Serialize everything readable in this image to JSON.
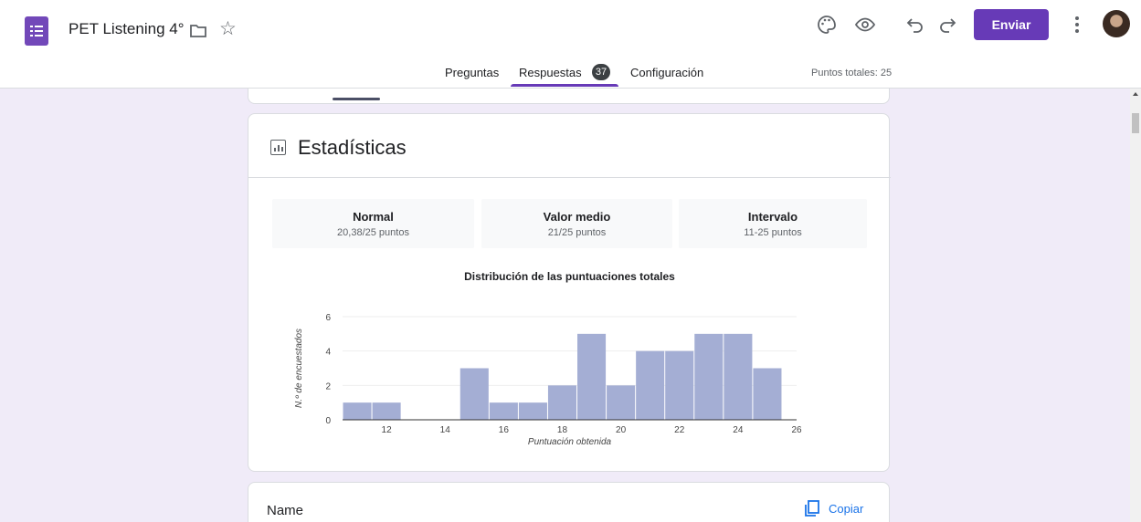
{
  "header": {
    "title": "PET Listening 4°",
    "send_label": "Enviar"
  },
  "tabs": [
    {
      "label": "Preguntas"
    },
    {
      "label": "Respuestas",
      "badge": "37"
    },
    {
      "label": "Configuración"
    }
  ],
  "total_points": "Puntos totales: 25",
  "stats": {
    "title": "Estadísticas",
    "boxes": [
      {
        "label": "Normal",
        "value": "20,38/25 puntos"
      },
      {
        "label": "Valor medio",
        "value": "21/25 puntos"
      },
      {
        "label": "Intervalo",
        "value": "11-25 puntos"
      }
    ]
  },
  "chart_data": {
    "type": "bar",
    "title": "Distribución de las puntuaciones totales",
    "xlabel": "Puntuación obtenida",
    "ylabel": "N.º de encuestados",
    "x_ticks": [
      12,
      14,
      16,
      18,
      20,
      22,
      24,
      26
    ],
    "y_ticks": [
      0,
      2,
      4,
      6
    ],
    "xlim": [
      10.5,
      26
    ],
    "ylim": [
      0,
      6
    ],
    "bar_color": "#a4aed4",
    "bars": [
      {
        "x": 11,
        "value": 1
      },
      {
        "x": 12,
        "value": 1
      },
      {
        "x": 13,
        "value": 0
      },
      {
        "x": 14,
        "value": 0
      },
      {
        "x": 15,
        "value": 3
      },
      {
        "x": 16,
        "value": 1
      },
      {
        "x": 17,
        "value": 1
      },
      {
        "x": 18,
        "value": 2
      },
      {
        "x": 19,
        "value": 5
      },
      {
        "x": 20,
        "value": 2
      },
      {
        "x": 21,
        "value": 4
      },
      {
        "x": 22,
        "value": 4
      },
      {
        "x": 23,
        "value": 5
      },
      {
        "x": 24,
        "value": 5
      },
      {
        "x": 25,
        "value": 3
      }
    ]
  },
  "name_card": {
    "label": "Name",
    "copy_label": "Copiar"
  },
  "colors": {
    "accent": "#673ab7",
    "background": "#f0ebf8",
    "link": "#1a73e8"
  }
}
